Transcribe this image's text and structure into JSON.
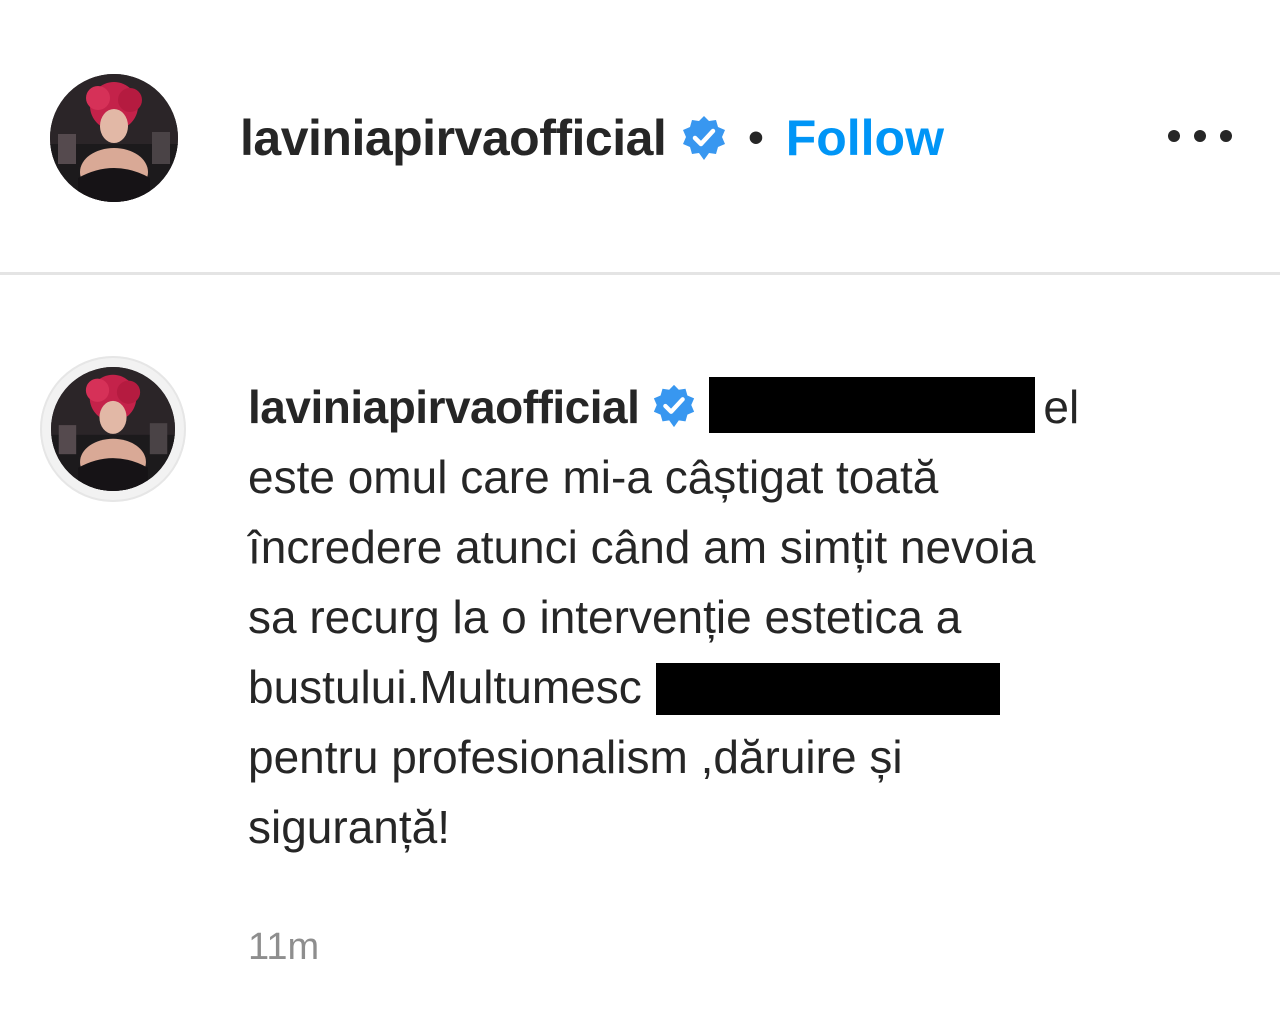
{
  "post_header": {
    "username": "laviniapirvaofficial",
    "verified": true,
    "separator": "•",
    "follow_label": "Follow",
    "more_icon": "more-horizontal-icon"
  },
  "comment": {
    "username": "laviniapirvaofficial",
    "verified": true,
    "lines": [
      "el",
      "este omul care mi-a câștigat toată",
      "încredere atunci când am simțit nevoia",
      "sa recurg la o intervenție estetica a",
      "bustului.Multumesc",
      "pentru profesionalism ,dăruire și",
      "siguranță!"
    ],
    "timestamp": "11m"
  },
  "colors": {
    "text": "#262626",
    "follow": "#0095f6",
    "verified_badge": "#3897f0",
    "muted": "#8e8e8e",
    "redaction": "#000000"
  }
}
